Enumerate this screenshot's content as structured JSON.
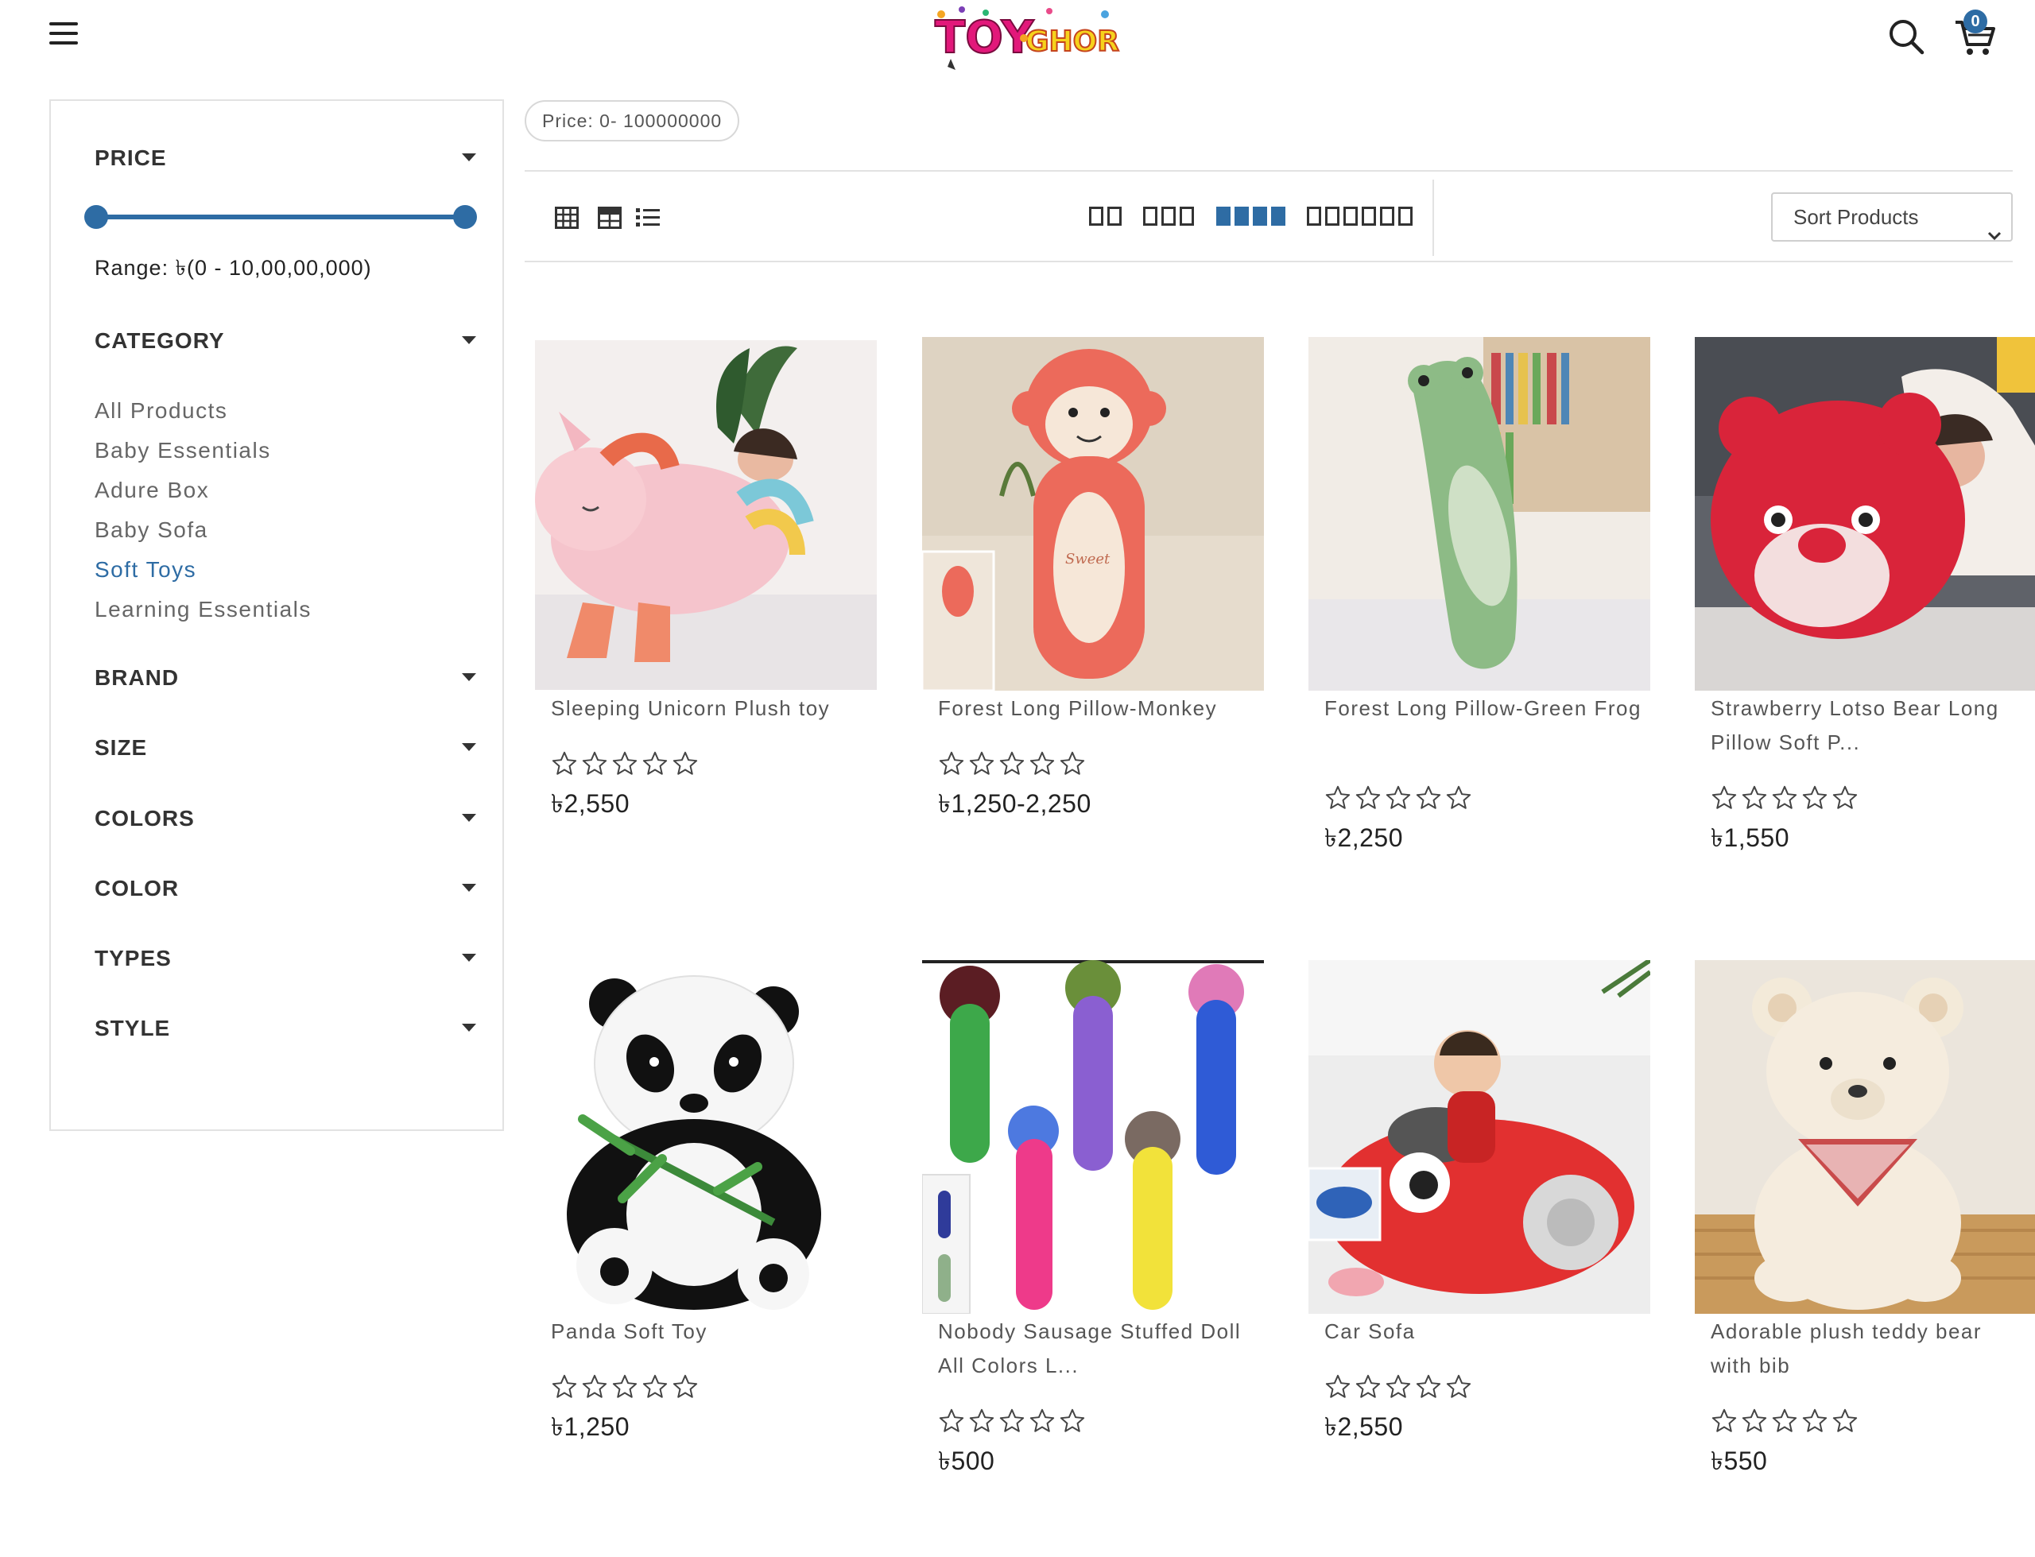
{
  "header": {
    "menu_icon": "hamburger-icon",
    "logo_text": "TOY GHOR",
    "cart_count": "0"
  },
  "filters": {
    "price_title": "PRICE",
    "range_label": "Range: ৳(0 - 10,00,00,000)",
    "category_title": "CATEGORY",
    "categories": [
      "All Products",
      "Baby Essentials",
      "Adure Box",
      "Baby Sofa",
      "Soft Toys",
      "Learning Essentials"
    ],
    "active_category": "Soft Toys",
    "brand_title": "BRAND",
    "size_title": "SIZE",
    "colors_title": "COLORS",
    "color_title": "COLOR",
    "types_title": "TYPES",
    "style_title": "STYLE"
  },
  "toolbar": {
    "price_chip": "Price: 0- 100000000",
    "sort_label": "Sort Products",
    "active_columns": 4
  },
  "products": [
    {
      "name": "Sleeping Unicorn Plush toy",
      "rating": 0,
      "price": "৳2,550"
    },
    {
      "name": "Forest Long Pillow-Monkey",
      "rating": 0,
      "price": "৳1,250-2,250"
    },
    {
      "name": "Forest Long Pillow-Green Frog",
      "rating": 0,
      "price": "৳2,250"
    },
    {
      "name": "Strawberry Lotso Bear Long Pillow Soft P...",
      "rating": 0,
      "price": "৳1,550"
    },
    {
      "name": "Panda Soft Toy",
      "rating": 0,
      "price": "৳1,250"
    },
    {
      "name": "Nobody Sausage Stuffed Doll All Colors L...",
      "rating": 0,
      "price": "৳500"
    },
    {
      "name": "Car Sofa",
      "rating": 0,
      "price": "৳2,550"
    },
    {
      "name": "Adorable plush teddy bear with bib",
      "rating": 0,
      "price": "৳550"
    }
  ],
  "colors": {
    "accent": "#2e6ca4",
    "text": "#333333"
  }
}
